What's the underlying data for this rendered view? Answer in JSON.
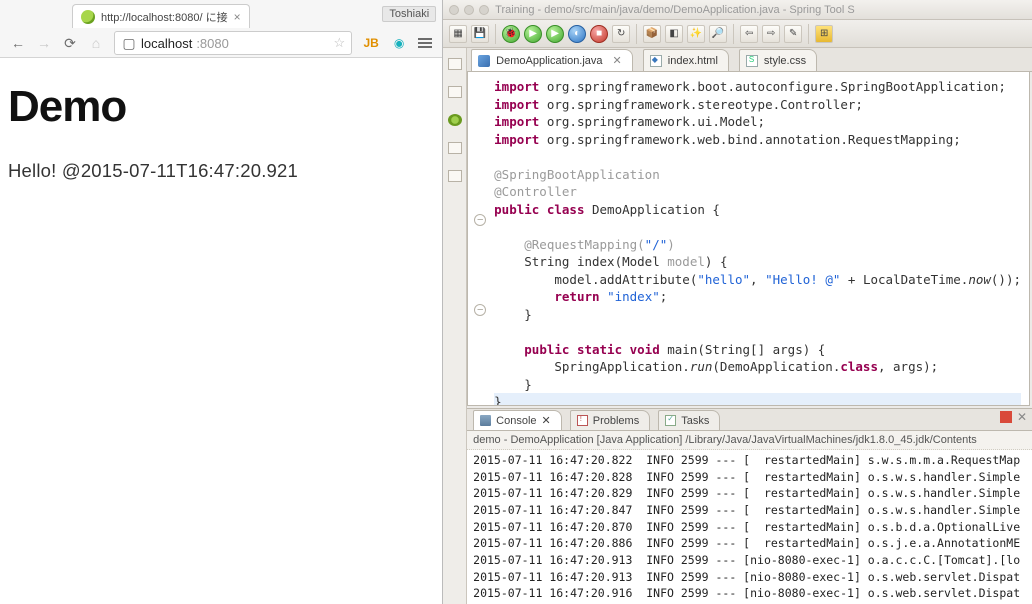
{
  "browser": {
    "profile": "Toshiaki",
    "tab_title": "http://localhost:8080/ に接",
    "url_host": "localhost",
    "url_port": ":8080",
    "back_glyph": "←",
    "fwd_glyph": "→",
    "reload_glyph": "⟳",
    "home_glyph": "⌂",
    "file_glyph": "▢",
    "star_glyph": "☆",
    "jb_label": "JB",
    "close_glyph": "×",
    "page_title": "Demo",
    "page_body": "Hello! @2015-07-11T16:47:20.921"
  },
  "ide": {
    "title": "Training - demo/src/main/java/demo/DemoApplication.java - Spring Tool S",
    "editor_tabs": [
      {
        "label": "DemoApplication.java",
        "close": "✕",
        "active": true,
        "icon": "j"
      },
      {
        "label": "index.html",
        "close": "",
        "active": false,
        "icon": "h"
      },
      {
        "label": "style.css",
        "close": "",
        "active": false,
        "icon": "c"
      }
    ],
    "panel_tabs": [
      {
        "label": "Console",
        "close": "✕",
        "active": true,
        "icon": "console"
      },
      {
        "label": "Problems",
        "close": "",
        "active": false,
        "icon": "problems"
      },
      {
        "label": "Tasks",
        "close": "",
        "active": false,
        "icon": "tasks"
      }
    ],
    "code": {
      "l1a": "import",
      "l1b": " org.springframework.boot.autoconfigure.SpringBootApplication;",
      "l2a": "import",
      "l2b": " org.springframework.stereotype.Controller;",
      "l3a": "import",
      "l3b": " org.springframework.ui.Model;",
      "l4a": "import",
      "l4b": " org.springframework.web.bind.annotation.RequestMapping;",
      "l6": "@SpringBootApplication",
      "l7": "@Controller",
      "l8a": "public class",
      "l8b": " DemoApplication {",
      "l10a": "    @RequestMapping(",
      "l10b": "\"/\"",
      "l10c": ")",
      "l11a": "    String index(Model ",
      "l11b": "model",
      "l11c": ") {",
      "l12a": "        model.addAttribute(",
      "l12b": "\"hello\"",
      "l12c": ", ",
      "l12d": "\"Hello! @\"",
      "l12e": " + LocalDateTime.",
      "l12f": "now",
      "l12g": "());",
      "l13a": "        ",
      "l13b": "return ",
      "l13c": "\"index\"",
      "l13d": ";",
      "l14": "    }",
      "l16a": "    ",
      "l16b": "public static void",
      "l16c": " main(String[] args) {",
      "l17a": "        SpringApplication.",
      "l17b": "run",
      "l17c": "(DemoApplication.",
      "l17d": "class",
      "l17e": ", args);",
      "l18": "    }",
      "l19": "}"
    },
    "console_header": "demo - DemoApplication [Java Application] /Library/Java/JavaVirtualMachines/jdk1.8.0_45.jdk/Contents",
    "console_lines": [
      "2015-07-11 16:47:20.822  INFO 2599 --- [  restartedMain] s.w.s.m.m.a.RequestMap",
      "2015-07-11 16:47:20.828  INFO 2599 --- [  restartedMain] o.s.w.s.handler.Simple",
      "2015-07-11 16:47:20.829  INFO 2599 --- [  restartedMain] o.s.w.s.handler.Simple",
      "2015-07-11 16:47:20.847  INFO 2599 --- [  restartedMain] o.s.w.s.handler.Simple",
      "2015-07-11 16:47:20.870  INFO 2599 --- [  restartedMain] o.s.b.d.a.OptionalLive",
      "2015-07-11 16:47:20.886  INFO 2599 --- [  restartedMain] o.s.j.e.a.AnnotationME",
      "2015-07-11 16:47:20.913  INFO 2599 --- [nio-8080-exec-1] o.a.c.c.C.[Tomcat].[lo",
      "2015-07-11 16:47:20.913  INFO 2599 --- [nio-8080-exec-1] o.s.web.servlet.Dispat",
      "2015-07-11 16:47:20.916  INFO 2599 --- [nio-8080-exec-1] o.s.web.servlet.Dispat"
    ]
  }
}
